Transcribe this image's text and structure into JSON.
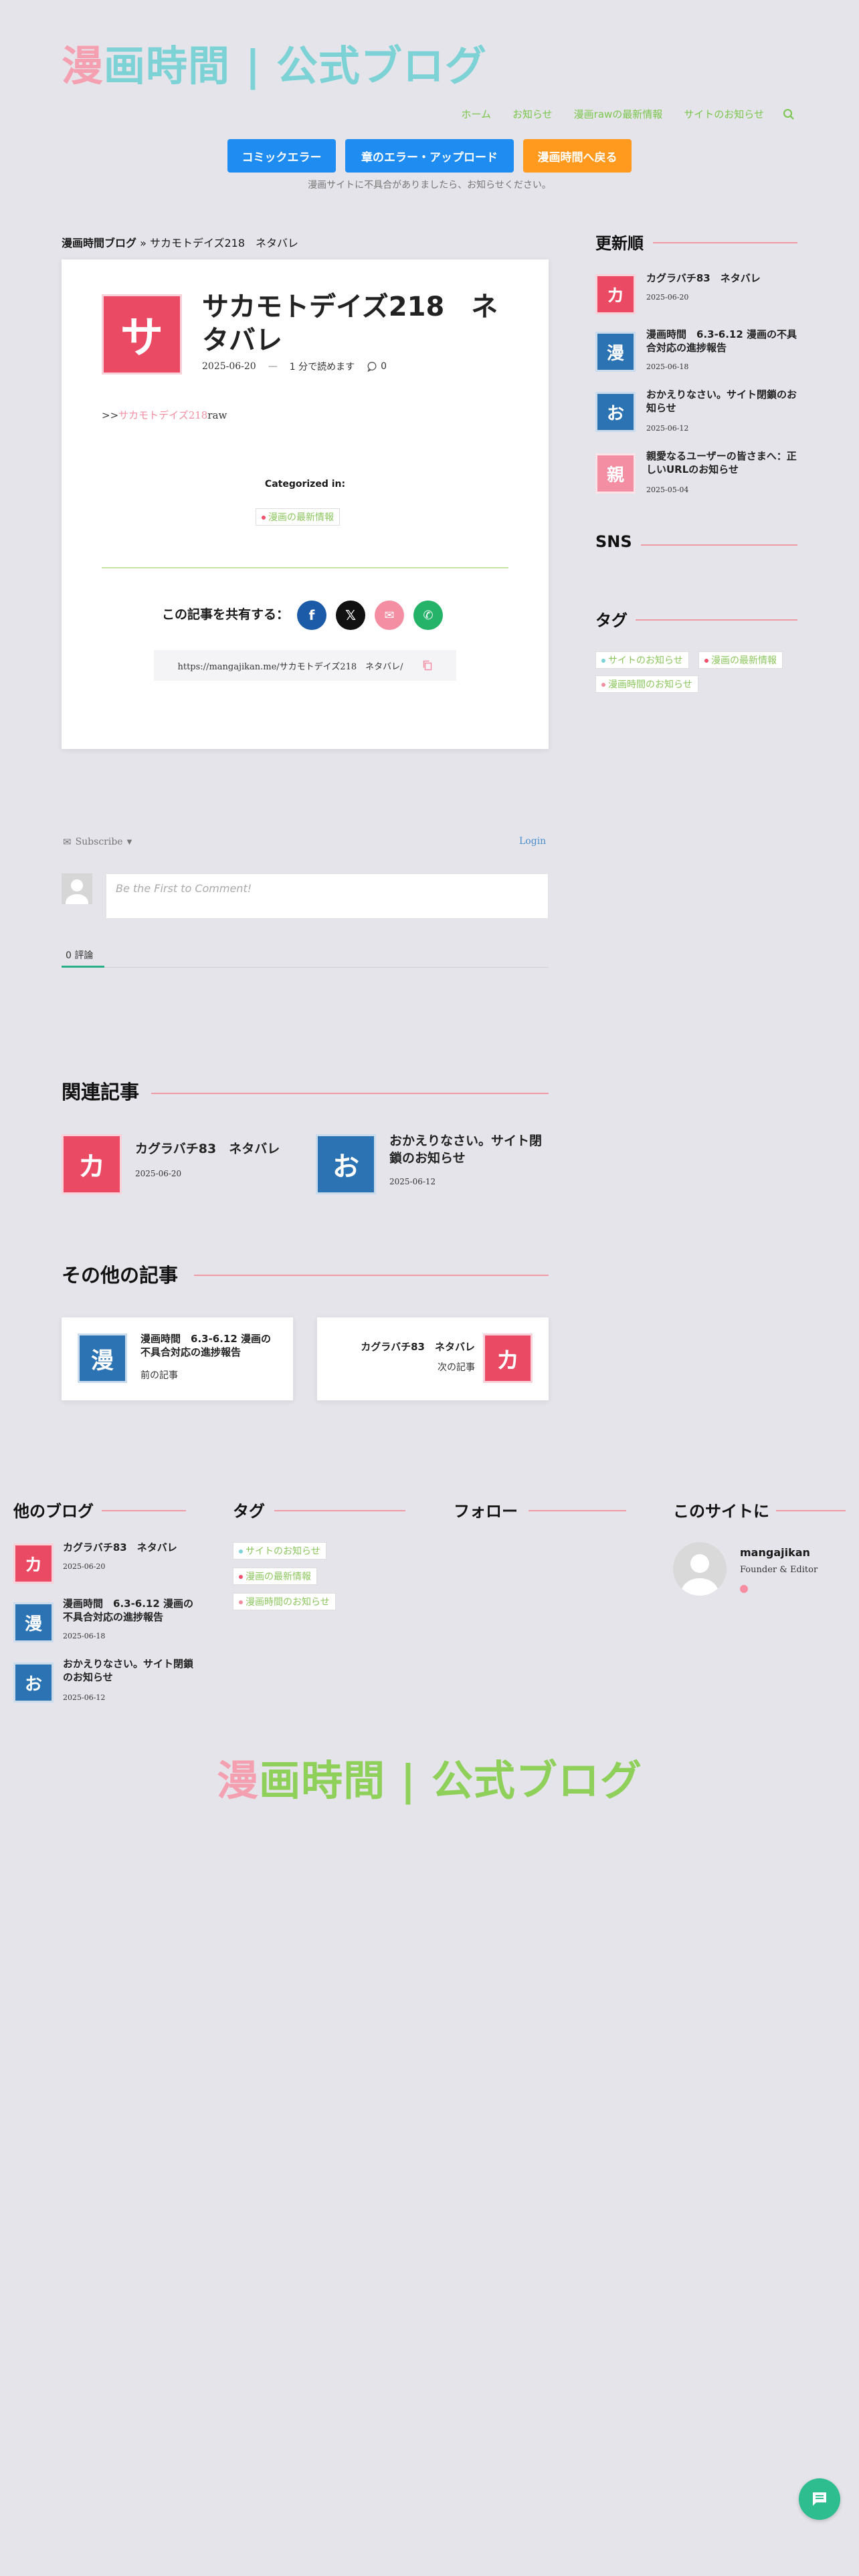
{
  "header": {
    "logo_a": "漫",
    "logo_b": "画時間 | 公式ブログ",
    "nav": [
      "ホーム",
      "お知らせ",
      "漫画rawの最新情報",
      "サイトのお知らせ"
    ],
    "buttons": [
      "コミックエラー",
      "章のエラー・アップロード",
      "漫画時間へ戻る"
    ],
    "notice": "漫画サイトに不具合がありましたら、お知らせください。"
  },
  "breadcrumb": {
    "home": "漫画時間ブログ",
    "sep": " » ",
    "current": "サカモトデイズ218　ネタバレ"
  },
  "article": {
    "thumb": "サ",
    "title": "サカモトデイズ218　ネタバレ",
    "date": "2025-06-20",
    "dash": "—",
    "read_time": "1 分で読めます",
    "comments": "0",
    "body_prefix": ">>",
    "body_link": "サカモトデイズ218",
    "body_suffix": "raw",
    "categorized_label": "Categorized in:",
    "category": "漫画の最新情報",
    "share_label": "この記事を共有する：",
    "share_url": "https://mangajikan.me/サカモトデイズ218　ネタバレ/"
  },
  "comments_box": {
    "subscribe": "Subscribe",
    "login": "Login",
    "placeholder": "Be the First to Comment!",
    "tab": "0 評論"
  },
  "related": {
    "title": "関連記事",
    "items": [
      {
        "thumb": "カ",
        "title": "カグラバチ83　ネタバレ",
        "date": "2025-06-20"
      },
      {
        "thumb": "お",
        "title": "おかえりなさい。サイト閉鎖のお知らせ",
        "date": "2025-06-12"
      }
    ]
  },
  "other": {
    "title": "その他の記事",
    "prev": {
      "thumb": "漫",
      "title": "漫画時間　6.3-6.12 漫画の不具合対応の進捗報告",
      "label": "前の記事"
    },
    "next": {
      "thumb": "カ",
      "title": "カグラバチ83　ネタバレ",
      "label": "次の記事"
    }
  },
  "sidebar": {
    "recent_title": "更新順",
    "recent": [
      {
        "thumb": "カ",
        "title": "カグラバチ83　ネタバレ",
        "date": "2025-06-20"
      },
      {
        "thumb": "漫",
        "title": "漫画時間　6.3-6.12 漫画の不具合対応の進捗報告",
        "date": "2025-06-18"
      },
      {
        "thumb": "お",
        "title": "おかえりなさい。サイト閉鎖のお知らせ",
        "date": "2025-06-12"
      },
      {
        "thumb": "親",
        "title": "親愛なるユーザーの皆さまへ：正しいURLのお知らせ",
        "date": "2025-05-04"
      }
    ],
    "sns_title": "SNS",
    "tags_title": "タグ",
    "tags": [
      "サイトのお知らせ",
      "漫画の最新情報",
      "漫画時間のお知らせ"
    ]
  },
  "footer": {
    "blog_title": "他のブログ",
    "blog": [
      {
        "thumb": "カ",
        "title": "カグラバチ83　ネタバレ",
        "date": "2025-06-20"
      },
      {
        "thumb": "漫",
        "title": "漫画時間　6.3-6.12 漫画の不具合対応の進捗報告",
        "date": "2025-06-18"
      },
      {
        "thumb": "お",
        "title": "おかえりなさい。サイト閉鎖のお知らせ",
        "date": "2025-06-12"
      }
    ],
    "tags_title": "タグ",
    "tags": [
      "サイトのお知らせ",
      "漫画の最新情報",
      "漫画時間のお知らせ"
    ],
    "follow_title": "フォロー",
    "about_title": "このサイトに",
    "author_name": "mangajikan",
    "author_role": "Founder & Editor",
    "logo_a": "漫",
    "logo_b": "画時間 | 公式ブログ"
  },
  "colors": {
    "accent_green": "#7ac64a",
    "accent_red": "#ea4a63",
    "btn_blue": "#1e8cf0",
    "btn_orange": "#ff9a1f"
  }
}
